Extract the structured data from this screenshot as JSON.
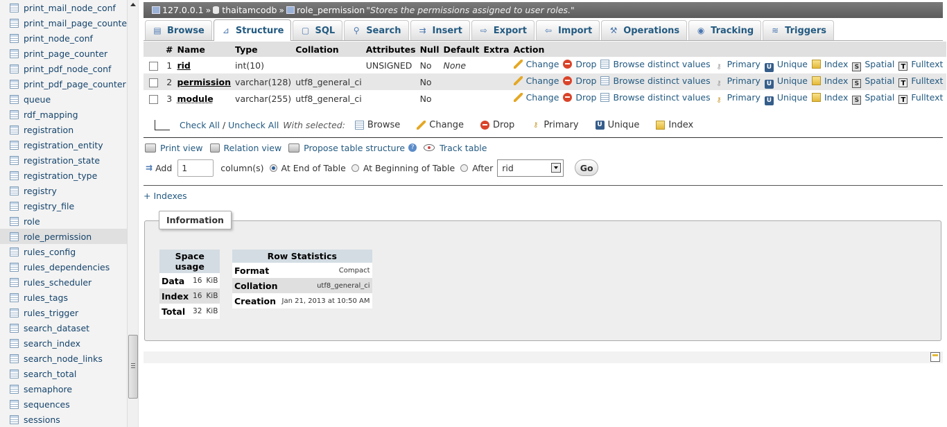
{
  "sidebar": {
    "tables": [
      "print_mail_node_conf",
      "print_mail_page_counter",
      "print_node_conf",
      "print_page_counter",
      "print_pdf_node_conf",
      "print_pdf_page_counter",
      "queue",
      "rdf_mapping",
      "registration",
      "registration_entity",
      "registration_state",
      "registration_type",
      "registry",
      "registry_file",
      "role",
      "role_permission",
      "rules_config",
      "rules_dependencies",
      "rules_scheduler",
      "rules_tags",
      "rules_trigger",
      "search_dataset",
      "search_index",
      "search_node_links",
      "search_total",
      "semaphore",
      "sequences",
      "sessions"
    ],
    "active": "role_permission"
  },
  "breadcrumb": {
    "server": "127.0.0.1",
    "database": "thaitamcodb",
    "table": "role_permission",
    "comment": "\"Stores the permissions assigned to user roles.\"",
    "separator": "»"
  },
  "tabs": [
    {
      "label": "Browse",
      "icon": "browse-icon"
    },
    {
      "label": "Structure",
      "icon": "structure-icon"
    },
    {
      "label": "SQL",
      "icon": "sql-icon"
    },
    {
      "label": "Search",
      "icon": "search-icon"
    },
    {
      "label": "Insert",
      "icon": "insert-icon"
    },
    {
      "label": "Export",
      "icon": "export-icon"
    },
    {
      "label": "Import",
      "icon": "import-icon"
    },
    {
      "label": "Operations",
      "icon": "operations-icon"
    },
    {
      "label": "Tracking",
      "icon": "tracking-icon"
    },
    {
      "label": "Triggers",
      "icon": "triggers-icon"
    }
  ],
  "structure": {
    "headers": [
      "#",
      "Name",
      "Type",
      "Collation",
      "Attributes",
      "Null",
      "Default",
      "Extra",
      "Action"
    ],
    "rows": [
      {
        "num": "1",
        "name": "rid",
        "type": "int(10)",
        "collation": "",
        "attributes": "UNSIGNED",
        "null": "No",
        "default": "None",
        "extra": ""
      },
      {
        "num": "2",
        "name": "permission",
        "type": "varchar(128)",
        "collation": "utf8_general_ci",
        "attributes": "",
        "null": "No",
        "default": "",
        "extra": ""
      },
      {
        "num": "3",
        "name": "module",
        "type": "varchar(255)",
        "collation": "utf8_general_ci",
        "attributes": "",
        "null": "No",
        "default": "",
        "extra": ""
      }
    ],
    "actions": {
      "change": "Change",
      "drop": "Drop",
      "browse_distinct": "Browse distinct values",
      "primary": "Primary",
      "unique": "Unique",
      "index": "Index",
      "spatial": "Spatial",
      "fulltext": "Fulltext"
    }
  },
  "with_selected": {
    "check_all": "Check All",
    "slash": "/",
    "uncheck_all": "Uncheck All",
    "label": "With selected:",
    "browse": "Browse",
    "change": "Change",
    "drop": "Drop",
    "primary": "Primary",
    "unique": "Unique",
    "index": "Index"
  },
  "links": {
    "print_view": "Print view",
    "relation_view": "Relation view",
    "propose_structure": "Propose table structure",
    "track_table": "Track table"
  },
  "add_columns": {
    "add_label": "Add",
    "count": "1",
    "columns_label": "column(s)",
    "at_end": "At End of Table",
    "at_beginning": "At Beginning of Table",
    "after": "After",
    "after_value": "rid",
    "go": "Go"
  },
  "indexes_link": "+ Indexes",
  "information": {
    "legend": "Information",
    "space_usage": {
      "title": "Space usage",
      "rows": [
        {
          "label": "Data",
          "value": "16",
          "unit": "KiB"
        },
        {
          "label": "Index",
          "value": "16",
          "unit": "KiB"
        },
        {
          "label": "Total",
          "value": "32",
          "unit": "KiB"
        }
      ]
    },
    "row_statistics": {
      "title": "Row Statistics",
      "rows": [
        {
          "label": "Format",
          "value": "Compact"
        },
        {
          "label": "Collation",
          "value": "utf8_general_ci"
        },
        {
          "label": "Creation",
          "value": "Jan 21, 2013 at 10:50 AM"
        }
      ]
    }
  }
}
